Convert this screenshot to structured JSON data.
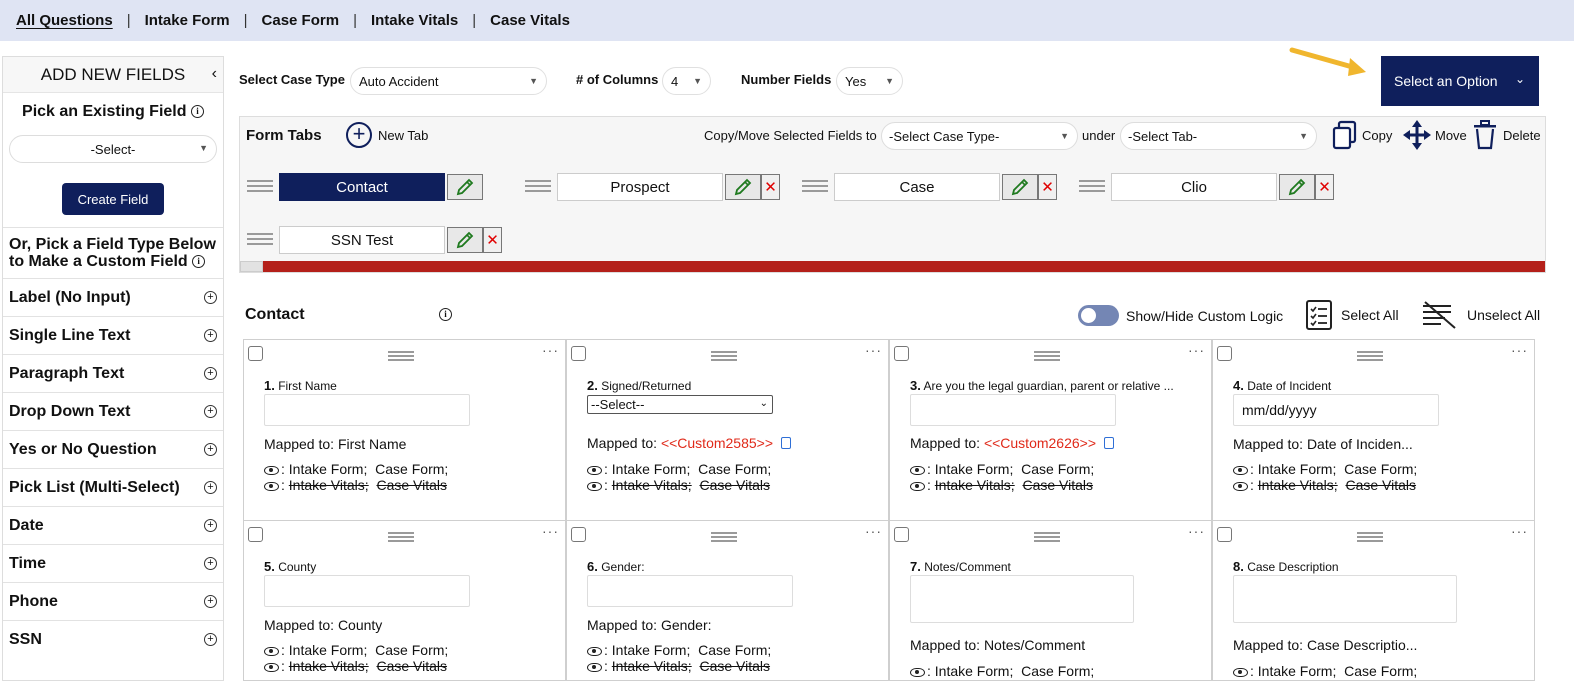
{
  "nav": {
    "items": [
      {
        "label": "All Questions"
      },
      {
        "label": "Intake Form"
      },
      {
        "label": "Case Form"
      },
      {
        "label": "Intake Vitals"
      },
      {
        "label": "Case Vitals"
      }
    ],
    "separator": "|"
  },
  "sidebar": {
    "title": "ADD NEW FIELDS",
    "collapse_icon": "chevron-left-icon",
    "pick_existing": "Pick an Existing Field",
    "existing_select": "-Select-",
    "create_button": "Create Field",
    "custom_heading": "Or, Pick a Field Type Below to Make a Custom Field",
    "field_types": [
      "Label (No Input)",
      "Single Line Text",
      "Paragraph Text",
      "Drop Down Text",
      "Yes or No Question",
      "Pick List (Multi-Select)",
      "Date",
      "Time",
      "Phone",
      "SSN"
    ]
  },
  "filters": {
    "case_type_label": "Select Case Type",
    "case_type_value": "Auto Accident",
    "columns_label": "# of Columns",
    "columns_value": "4",
    "number_fields_label": "Number Fields",
    "number_fields_value": "Yes"
  },
  "option_button": {
    "label": "Select an Option"
  },
  "form_tabs": {
    "title": "Form Tabs",
    "new_tab": "New Tab",
    "copy_move_label": "Copy/Move Selected Fields to",
    "case_type_select": "-Select Case Type-",
    "under_label": "under",
    "tab_select": "-Select Tab-",
    "copy": "Copy",
    "move": "Move",
    "delete": "Delete",
    "tabs": [
      {
        "label": "Contact",
        "active": true
      },
      {
        "label": "Prospect"
      },
      {
        "label": "Case"
      },
      {
        "label": "Clio"
      },
      {
        "label": "SSN Test"
      }
    ]
  },
  "section": {
    "title": "Contact",
    "show_hide": "Show/Hide Custom Logic",
    "select_all": "Select All",
    "unselect_all": "Unselect All"
  },
  "visibility": {
    "intake_form": "Intake Form;",
    "case_form": "Case Form;",
    "intake_vitals": "Intake Vitals;",
    "case_vitals": "Case Vitals"
  },
  "fields": [
    {
      "num": "1.",
      "label": "First Name",
      "mapped_prefix": "Mapped to: ",
      "mapped": "First Name"
    },
    {
      "num": "2.",
      "label": "Signed/Returned",
      "select_value": "--Select--",
      "mapped_prefix": "Mapped to: ",
      "mapped": "<<Custom2585>>"
    },
    {
      "num": "3.",
      "label": "Are you the legal guardian, parent or relative ...",
      "mapped_prefix": "Mapped to: ",
      "mapped": "<<Custom2626>>"
    },
    {
      "num": "4.",
      "label": "Date of Incident",
      "input_value": "mm/dd/yyyy",
      "mapped_prefix": "Mapped to: ",
      "mapped": "Date of Inciden..."
    },
    {
      "num": "5.",
      "label": "County",
      "mapped_prefix": "Mapped to: ",
      "mapped": "County"
    },
    {
      "num": "6.",
      "label": "Gender:",
      "mapped_prefix": "Mapped to: ",
      "mapped": "Gender:"
    },
    {
      "num": "7.",
      "label": "Notes/Comment",
      "mapped_prefix": "Mapped to: ",
      "mapped": "Notes/Comment"
    },
    {
      "num": "8.",
      "label": "Case Description",
      "mapped_prefix": "Mapped to: ",
      "mapped": "Case Descriptio..."
    }
  ],
  "colors": {
    "navy": "#0f1f5c",
    "nav_bg": "#dfe4f3",
    "custom_red": "#e02a1a",
    "tab_bar_red": "#b4201a",
    "arrow": "#f0b62e",
    "toggle": "#7486b4"
  }
}
